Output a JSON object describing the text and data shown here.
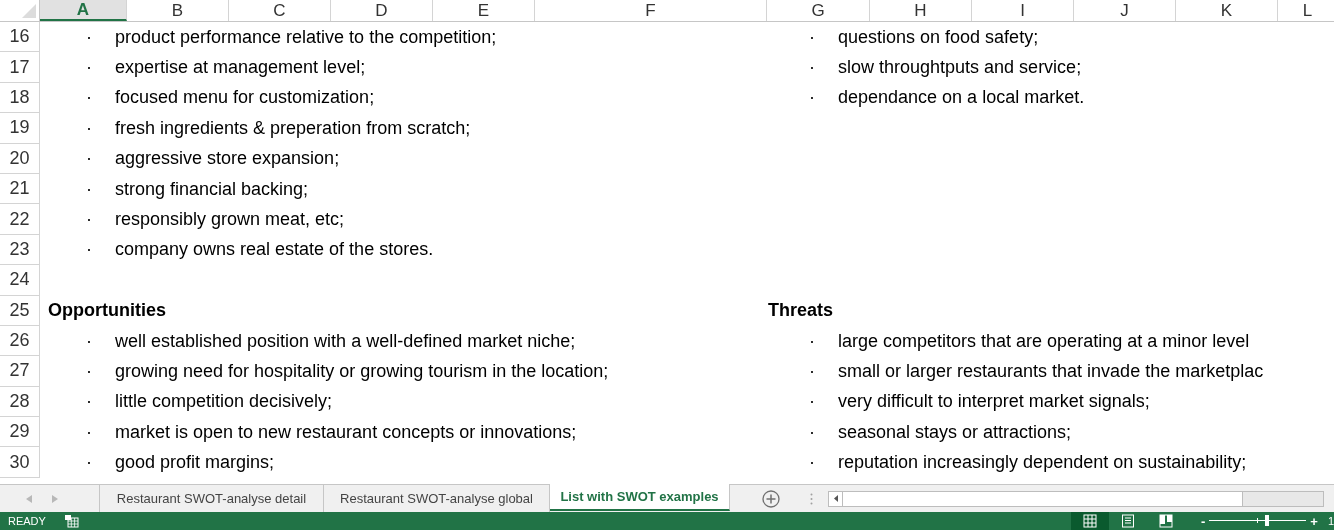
{
  "columns": [
    {
      "label": "A",
      "selected": true
    },
    {
      "label": "B",
      "selected": false
    },
    {
      "label": "C",
      "selected": false
    },
    {
      "label": "D",
      "selected": false
    },
    {
      "label": "E",
      "selected": false
    },
    {
      "label": "F",
      "selected": false
    },
    {
      "label": "G",
      "selected": false
    },
    {
      "label": "H",
      "selected": false
    },
    {
      "label": "I",
      "selected": false
    },
    {
      "label": "J",
      "selected": false
    },
    {
      "label": "K",
      "selected": false
    },
    {
      "label": "L",
      "selected": false
    }
  ],
  "rows": [
    {
      "number": "16",
      "left": {
        "kind": "bullet",
        "bullet": "·",
        "text": "product performance relative to the competition;"
      },
      "right": {
        "kind": "bullet",
        "bullet": "·",
        "text": "questions on food safety;"
      }
    },
    {
      "number": "17",
      "left": {
        "kind": "bullet",
        "bullet": "·",
        "text": "expertise at management level;"
      },
      "right": {
        "kind": "bullet",
        "bullet": "·",
        "text": "slow throughtputs and service;"
      }
    },
    {
      "number": "18",
      "left": {
        "kind": "bullet",
        "bullet": "·",
        "text": "focused menu for customization;"
      },
      "right": {
        "kind": "bullet",
        "bullet": "·",
        "text": "dependance on a local market."
      }
    },
    {
      "number": "19",
      "left": {
        "kind": "bullet",
        "bullet": "·",
        "text": "fresh ingredients & preperation from scratch;"
      }
    },
    {
      "number": "20",
      "left": {
        "kind": "bullet",
        "bullet": "·",
        "text": "aggressive store expansion;"
      }
    },
    {
      "number": "21",
      "left": {
        "kind": "bullet",
        "bullet": "·",
        "text": "strong financial backing;"
      }
    },
    {
      "number": "22",
      "left": {
        "kind": "bullet",
        "bullet": "·",
        "text": "responsibly grown meat, etc;"
      }
    },
    {
      "number": "23",
      "left": {
        "kind": "bullet",
        "bullet": "·",
        "text": "company owns real estate of the stores."
      }
    },
    {
      "number": "24"
    },
    {
      "number": "25",
      "left": {
        "kind": "heading",
        "text": "Opportunities"
      },
      "right": {
        "kind": "heading",
        "text": "Threats"
      }
    },
    {
      "number": "26",
      "left": {
        "kind": "bullet",
        "bullet": "·",
        "text": "well established position with a well-defined market niche;"
      },
      "right": {
        "kind": "bullet",
        "bullet": "·",
        "text": "large competitors that are operating at a minor level"
      }
    },
    {
      "number": "27",
      "left": {
        "kind": "bullet",
        "bullet": "·",
        "text": "growing need for hospitality or growing tourism in the location;"
      },
      "right": {
        "kind": "bullet",
        "bullet": "·",
        "text": "small or larger restaurants that invade the marketplac"
      }
    },
    {
      "number": "28",
      "left": {
        "kind": "bullet",
        "bullet": "·",
        "text": "little competition decisively;"
      },
      "right": {
        "kind": "bullet",
        "bullet": "·",
        "text": "very difficult to interpret market signals;"
      }
    },
    {
      "number": "29",
      "left": {
        "kind": "bullet",
        "bullet": "·",
        "text": "market is open to new restaurant concepts or innovations;"
      },
      "right": {
        "kind": "bullet",
        "bullet": "·",
        "text": "seasonal stays or attractions;"
      }
    },
    {
      "number": "30",
      "left": {
        "kind": "bullet",
        "bullet": "·",
        "text": "good profit margins;"
      },
      "right": {
        "kind": "bullet",
        "bullet": "·",
        "text": "reputation increasingly dependent on sustainability;"
      }
    }
  ],
  "sheet_tabs": [
    {
      "label": "Restaurant SWOT-analyse detail",
      "selected": false
    },
    {
      "label": "Restaurant SWOT-analyse global",
      "selected": false
    },
    {
      "label": "List with SWOT examples",
      "selected": true
    }
  ],
  "status_bar": {
    "mode": "READY",
    "views": [
      {
        "kind": "normal",
        "selected": true
      },
      {
        "kind": "layout",
        "selected": false
      },
      {
        "kind": "break",
        "selected": false
      }
    ],
    "zoom": {
      "minus": "-",
      "plus": "+",
      "level": 0.6,
      "reading": "1"
    }
  }
}
